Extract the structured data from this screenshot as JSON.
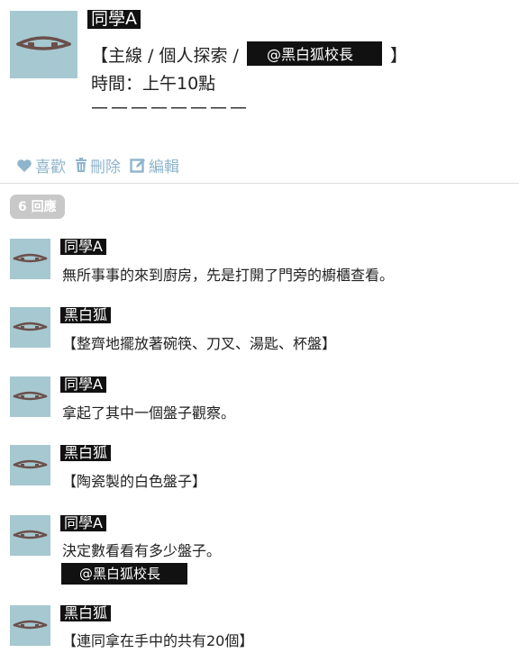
{
  "post": {
    "author": "同學A",
    "line1_prefix": "【主線 / 個人探索 /",
    "line1_mention": "@黑白狐校長",
    "line1_suffix": "】",
    "line2": "時間：上午10點",
    "line3": "————————"
  },
  "actions": [
    {
      "label": "喜歡",
      "icon": "heart-icon"
    },
    {
      "label": "刪除",
      "icon": "trash-icon"
    },
    {
      "label": "編輯",
      "icon": "edit-icon"
    }
  ],
  "reply_count": "6 回應",
  "replies": [
    {
      "author": "同學A",
      "text": "無所事事的來到廚房，先是打開了門旁的櫥櫃查看。"
    },
    {
      "author": "黑白狐",
      "text": "【整齊地擺放著碗筷、刀叉、湯匙、杯盤】"
    },
    {
      "author": "同學A",
      "text": "拿起了其中一個盤子觀察。"
    },
    {
      "author": "黑白狐",
      "text": "【陶瓷製的白色盤子】"
    },
    {
      "author": "同學A",
      "text": "決定數看看有多少盤子。",
      "mention": "@黑白狐校長"
    },
    {
      "author": "黑白狐",
      "text": "【連同拿在手中的共有20個】"
    }
  ],
  "colors": {
    "avatar_bg": "#a6c8d0",
    "action": "#8fb5cc",
    "badge": "#c8c8c8"
  }
}
